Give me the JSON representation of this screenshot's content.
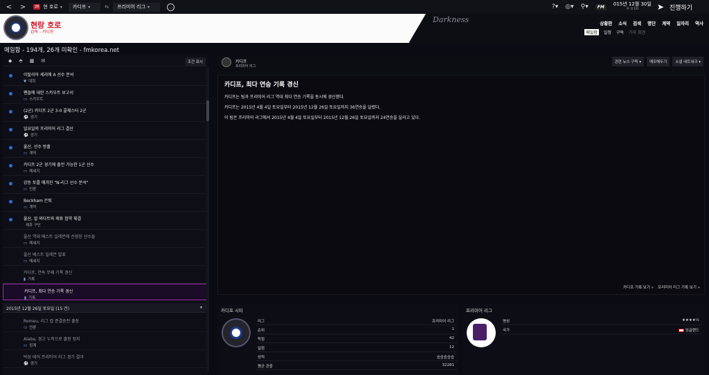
{
  "topbar": {
    "back": "<",
    "forward": ">",
    "badge": "28",
    "manager": "현 호로",
    "club": "카디프",
    "league": "프리미어 리그",
    "date_main": "015년 12월 30일",
    "date_sub": "수 0:00",
    "fm_logo": "FM",
    "continue": "진행하기"
  },
  "header": {
    "club_name": "현랑 호로",
    "club_sub": "감독 - 카디프",
    "skin": "Darkness",
    "menu": [
      "상황판",
      "소식",
      "검색",
      "명단",
      "계약",
      "일자리",
      "역사"
    ],
    "submenu": [
      "메일함",
      "일정",
      "구독",
      "기자 회견"
    ]
  },
  "page_title": "메일함 - 194개, 26개 미확인 - fmkorea.net",
  "left": {
    "filter_btn": "조건 표시",
    "messages": [
      {
        "title": "이탈리아 세리에 A 선수 분석",
        "cat": "대회",
        "icon": "▼",
        "unread": true
      },
      {
        "title": "팬들에 대한 스카우트 보고서",
        "cat": "스카우트",
        "icon": "▭",
        "unread": true
      },
      {
        "title": "(2군) 카디프 2군 3-0 콜체스터 2군",
        "cat": "경기",
        "icon": "⚽",
        "unread": true
      },
      {
        "title": "일요일의 프리미어 리그 결산",
        "cat": "경기",
        "icon": "⚽",
        "unread": true
      },
      {
        "title": "울산, 선수 방출",
        "cat": "계약",
        "icon": "▭",
        "unread": true
      },
      {
        "title": "카디프 2군 경기에 출전 가능한 1군 선수",
        "cat": "메세지",
        "icon": "▭",
        "unread": true
      },
      {
        "title": "강등 토를 매겨진 \"N-리그 선수 분석\"",
        "cat": "언론",
        "icon": "▭",
        "unread": true
      },
      {
        "title": "Beckham 은퇴",
        "cat": "계약",
        "icon": "▭",
        "unread": true
      },
      {
        "title": "울산, 알 와다트와 제휴 협약 체결",
        "cat": "제휴 구단",
        "icon": "",
        "unread": true
      },
      {
        "title": "울산 역대 베스트 일레븐에 선정된 선수들",
        "cat": "메세지",
        "icon": "▭",
        "unread": false
      },
      {
        "title": "울산 베스트 일레븐 발표",
        "cat": "메세지",
        "icon": "▭",
        "unread": false
      },
      {
        "title": "카디프, 연속 무패 기록 경신",
        "cat": "기록",
        "icon": "▮",
        "unread": false
      },
      {
        "title": "카디프, 최다 연승 기록 경신",
        "cat": "기록",
        "icon": "▮",
        "unread": false,
        "selected": true
      }
    ],
    "date_group": "2015년 12월 26일 토요일 (15 건)",
    "date_group_caret": "▾",
    "messages2": [
      {
        "title": "Romeu, 리그 컵 준결승전 출장",
        "cat": "언론",
        "icon": "▭"
      },
      {
        "title": "Alaba, 경고 누적으로 출장 정지",
        "cat": "징계",
        "icon": "▭"
      },
      {
        "title": "박성 테어 프리미어 리그 경기 결과",
        "cat": "경기",
        "icon": "⚽"
      }
    ]
  },
  "right": {
    "sender": "카디프",
    "sender_sub": "프리미어 리그",
    "buttons": [
      "관련 뉴스 구독 ▾",
      "메모해두기",
      "소셜 네트워크 ▾"
    ],
    "heading": "카디프, 최다 연승 기록 경신",
    "paragraphs": [
      "카디프는 팀과 프리미어 리그 역대 최다 연승 기록을 동시에 경신했다.",
      "카디프는 2015년 4월 4일 토요일부터 2015년 12월 26일 토요일까지 36연승을 달렸다.",
      "이 팀은 프리미어 리그에서 2015년 4월 4일 토요일부터 2015년 12월 26일 토요일까지 24연승을 달리고 있다."
    ],
    "links": [
      "카디프 기록 보기 »",
      "프리미어 리그 기록 보기 »"
    ]
  },
  "club_card": {
    "title": "카디프 시티",
    "rows": [
      {
        "k": "리그",
        "v": "프리미어 리그"
      },
      {
        "k": "순위",
        "v": "1"
      },
      {
        "k": "득점",
        "v": "42"
      },
      {
        "k": "실점",
        "v": "12"
      },
      {
        "k": "성적",
        "v": "승승승승승"
      },
      {
        "k": "평균 관중",
        "v": "32281"
      }
    ]
  },
  "league_card": {
    "title": "프리미어 리그",
    "rows": [
      {
        "k": "명성",
        "v": "★★★★½"
      },
      {
        "k": "국가",
        "v": "잉글랜드"
      }
    ],
    "reputation_stars": 4.5
  }
}
